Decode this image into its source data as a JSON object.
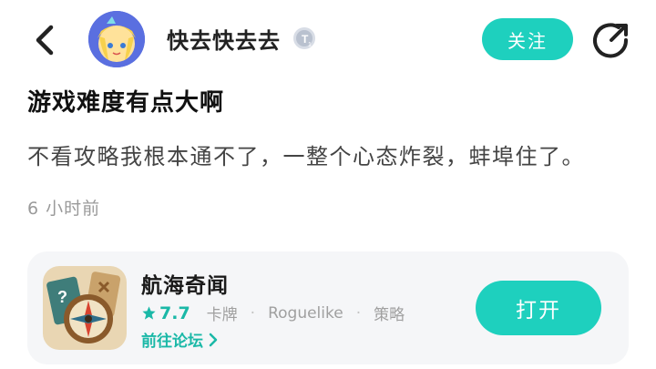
{
  "post": {
    "author": "快去快去去",
    "follow_label": "关注",
    "title": "游戏难度有点大啊",
    "content": "不看攻略我根本通不了，一整个心态炸裂，蚌埠住了。",
    "time": "6 小时前"
  },
  "game": {
    "name": "航海奇闻",
    "rating": "7.7",
    "tags": [
      "卡牌",
      "Roguelike",
      "策略"
    ],
    "forum_label": "前往论坛",
    "open_label": "打开"
  },
  "colors": {
    "accent": "#1ed0be",
    "accent_text": "#1ab8a7"
  },
  "icons": {
    "back": "chevron-left-icon",
    "share": "share-icon",
    "badge": "level-badge-icon",
    "star": "star-icon",
    "forum_arrow": "chevron-right-icon"
  }
}
